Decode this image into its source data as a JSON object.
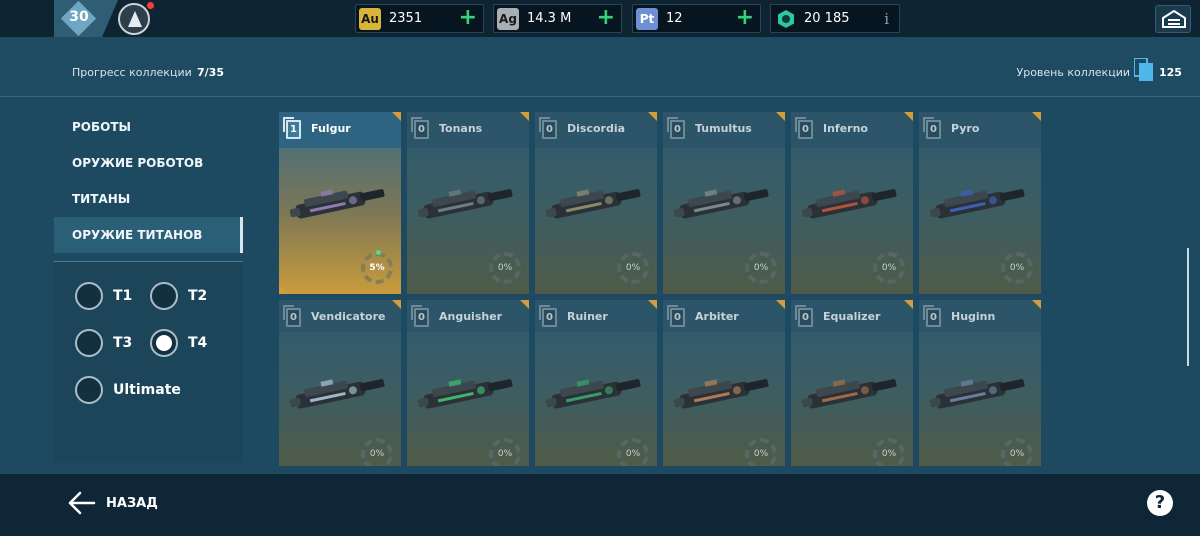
{
  "topbar": {
    "level": "30",
    "currencies": [
      {
        "code": "Au",
        "value": "2351",
        "color": "#d8b43a",
        "action": "plus"
      },
      {
        "code": "Ag",
        "value": "14.3 M",
        "color": "#a9b0b4",
        "action": "plus"
      },
      {
        "code": "Pt",
        "value": "12",
        "color": "#6f8fd4",
        "action": "plus"
      },
      {
        "code": "",
        "value": "20 185",
        "color": "#2fc7a3",
        "action": "info"
      }
    ],
    "plus_glyph": "+",
    "info_glyph": "i"
  },
  "collection": {
    "progress_label": "Прогресс коллекции",
    "progress_value": "7/35",
    "level_label": "Уровень коллекции",
    "level_value": "125"
  },
  "sidebar": {
    "menu": [
      {
        "label": "РОБОТЫ",
        "active": false
      },
      {
        "label": "ОРУЖИЕ РОБОТОВ",
        "active": false
      },
      {
        "label": "ТИТАНЫ",
        "active": false
      },
      {
        "label": "ОРУЖИЕ ТИТАНОВ",
        "active": true
      }
    ],
    "tiers": [
      {
        "label": "T1",
        "selected": false
      },
      {
        "label": "T2",
        "selected": false
      },
      {
        "label": "T3",
        "selected": false
      },
      {
        "label": "T4",
        "selected": true
      },
      {
        "label": "Ultimate",
        "selected": false
      }
    ]
  },
  "cards": [
    {
      "name": "Fulgur",
      "count": "1",
      "progress": "5%",
      "selected": true,
      "accent": "#8f7bb0"
    },
    {
      "name": "Tonans",
      "count": "0",
      "progress": "0%",
      "selected": false,
      "accent": "#6c7c86"
    },
    {
      "name": "Discordia",
      "count": "0",
      "progress": "0%",
      "selected": false,
      "accent": "#8a8a6a"
    },
    {
      "name": "Tumultus",
      "count": "0",
      "progress": "0%",
      "selected": false,
      "accent": "#7a8a8a"
    },
    {
      "name": "Inferno",
      "count": "0",
      "progress": "0%",
      "selected": false,
      "accent": "#b0553c"
    },
    {
      "name": "Pyro",
      "count": "0",
      "progress": "0%",
      "selected": false,
      "accent": "#3e5fb4"
    },
    {
      "name": "Vendicatore",
      "count": "0",
      "progress": "0%",
      "selected": false,
      "accent": "#9fb6c8"
    },
    {
      "name": "Anguisher",
      "count": "0",
      "progress": "0%",
      "selected": false,
      "accent": "#3fb46a"
    },
    {
      "name": "Ruiner",
      "count": "0",
      "progress": "0%",
      "selected": false,
      "accent": "#3a9a6a"
    },
    {
      "name": "Arbiter",
      "count": "0",
      "progress": "0%",
      "selected": false,
      "accent": "#b07a5a"
    },
    {
      "name": "Equalizer",
      "count": "0",
      "progress": "0%",
      "selected": false,
      "accent": "#a06a4a"
    },
    {
      "name": "Huginn",
      "count": "0",
      "progress": "0%",
      "selected": false,
      "accent": "#6a7e9a"
    }
  ],
  "footer": {
    "back_label": "НАЗАД",
    "help_glyph": "?"
  }
}
